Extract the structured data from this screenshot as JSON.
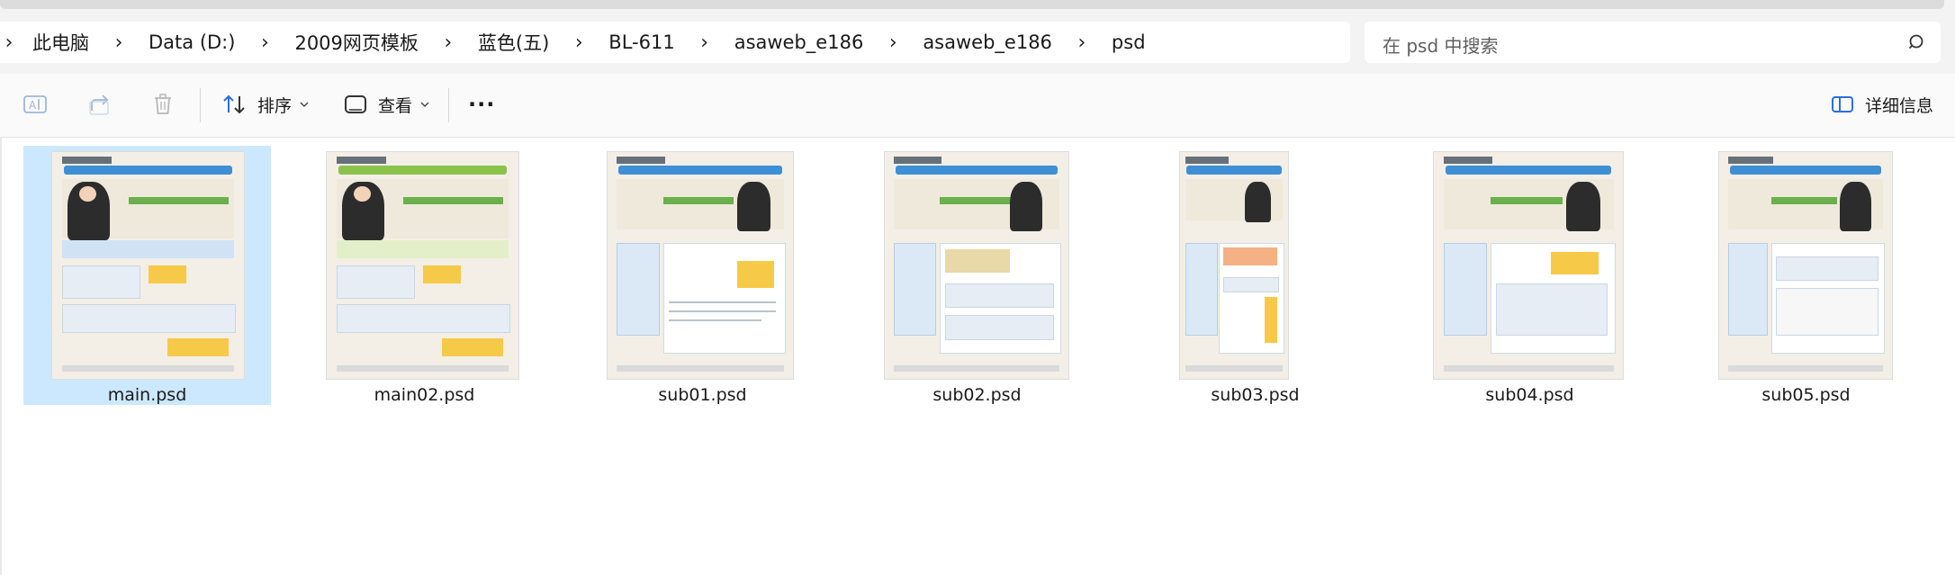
{
  "breadcrumb": {
    "items": [
      "此电脑",
      "Data (D:)",
      "2009网页模板",
      "蓝色(五)",
      "BL-611",
      "asaweb_e186",
      "asaweb_e186",
      "psd"
    ]
  },
  "search": {
    "placeholder": "在 psd 中搜索"
  },
  "toolbar": {
    "sort_label": "排序",
    "view_label": "查看",
    "more_label": "···",
    "details_label": "详细信息"
  },
  "files": [
    {
      "name": "main.psd",
      "selected": true
    },
    {
      "name": "main02.psd",
      "selected": false
    },
    {
      "name": "sub01.psd",
      "selected": false
    },
    {
      "name": "sub02.psd",
      "selected": false
    },
    {
      "name": "sub03.psd",
      "selected": false
    },
    {
      "name": "sub04.psd",
      "selected": false
    },
    {
      "name": "sub05.psd",
      "selected": false
    }
  ],
  "colors": {
    "selection": "#cce8ff",
    "accent": "#3e8fd4",
    "icon_blue": "#2a6fdb"
  }
}
